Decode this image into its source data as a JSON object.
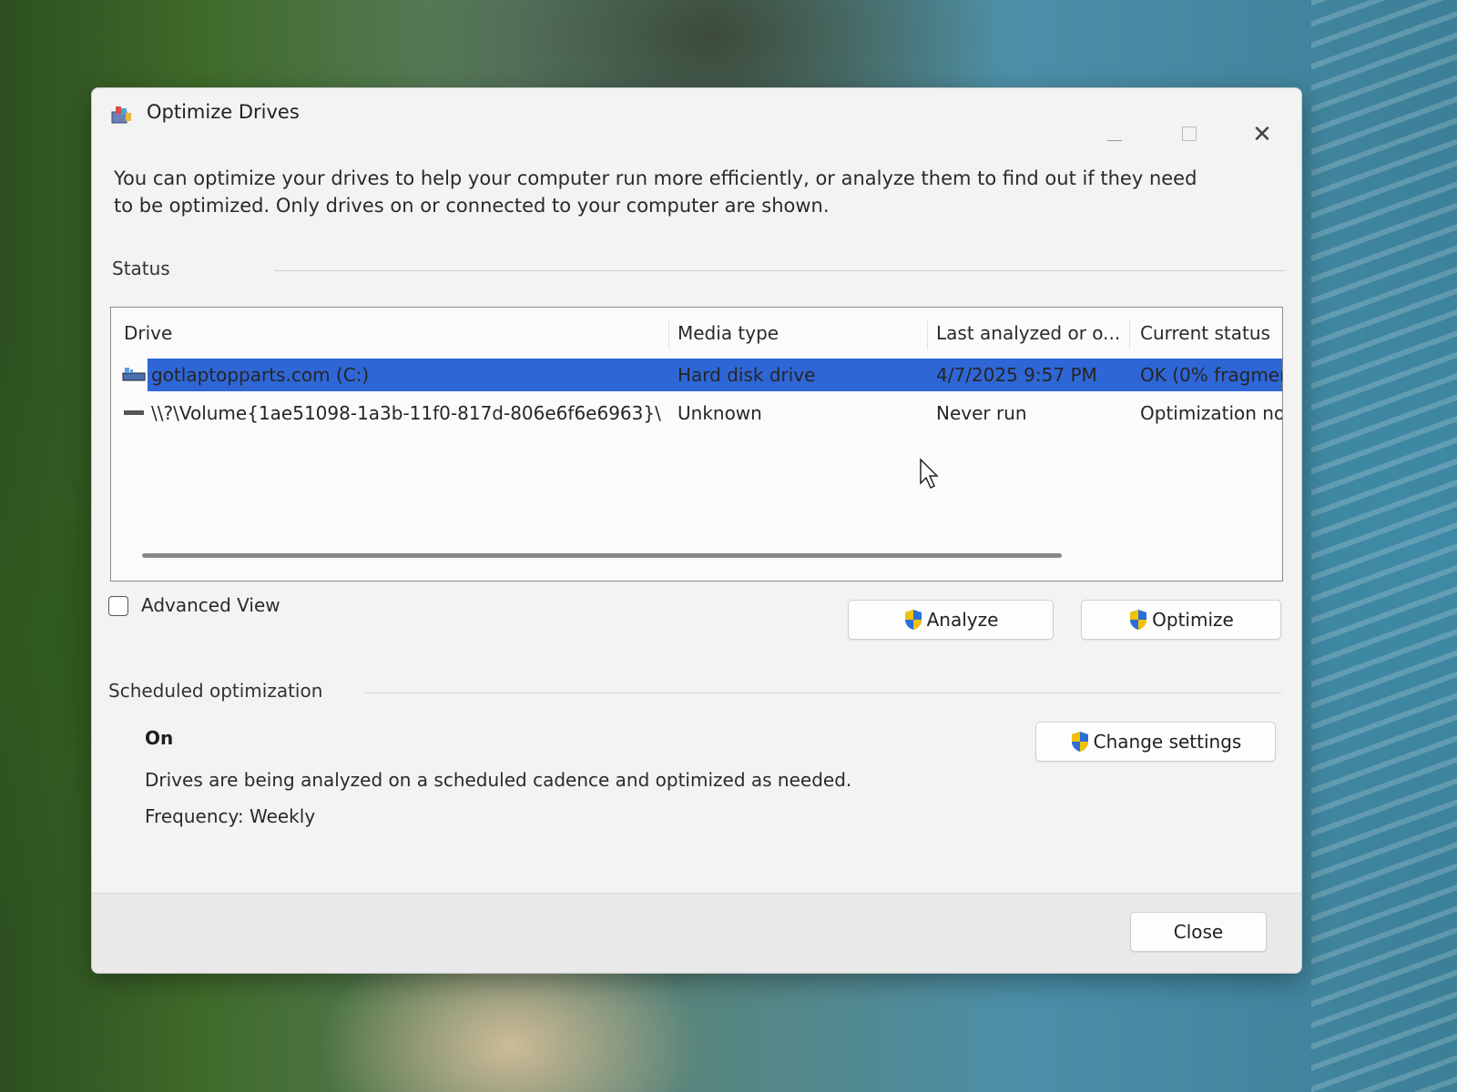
{
  "window": {
    "title": "Optimize Drives",
    "minimize_icon": "minimize-icon",
    "maximize_icon": "maximize-icon",
    "close_icon": "close-icon"
  },
  "description": "You can optimize your drives to help your computer run more efficiently, or analyze them to find out if they need to be optimized. Only drives on or connected to your computer are shown.",
  "status": {
    "label": "Status",
    "columns": [
      "Drive",
      "Media type",
      "Last analyzed or o...",
      "Current status"
    ],
    "rows": [
      {
        "drive": "gotlaptopparts.com (C:)",
        "media_type": "Hard disk drive",
        "last_analyzed": "4/7/2025 9:57 PM",
        "current_status": "OK (0% fragmen",
        "selected": true
      },
      {
        "drive": "\\\\?\\Volume{1ae51098-1a3b-11f0-817d-806e6f6e6963}\\",
        "media_type": "Unknown",
        "last_analyzed": "Never run",
        "current_status": "Optimization no",
        "selected": false
      }
    ]
  },
  "advanced_view": {
    "label": "Advanced View",
    "checked": false
  },
  "buttons": {
    "analyze": "Analyze",
    "optimize": "Optimize",
    "change_settings": "Change settings",
    "close": "Close"
  },
  "scheduled": {
    "label": "Scheduled optimization",
    "state": "On",
    "description": "Drives are being analyzed on a scheduled cadence and optimized as needed.",
    "frequency": "Frequency: Weekly"
  },
  "colors": {
    "selection": "#2f66d6",
    "window_bg": "#f3f3f3",
    "shield_blue": "#2b6fd6",
    "shield_yellow": "#f2c200"
  }
}
